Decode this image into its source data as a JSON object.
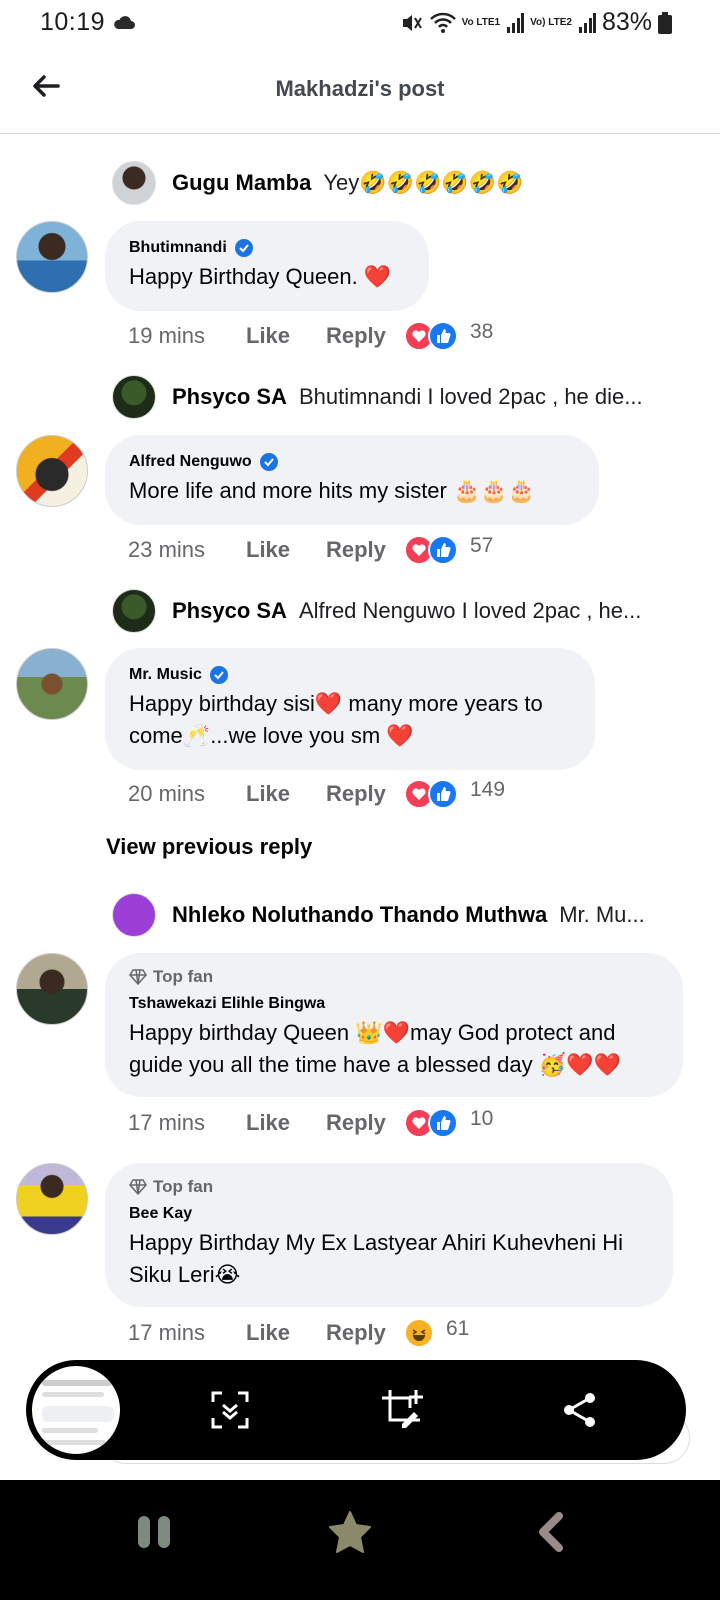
{
  "status": {
    "time": "10:19",
    "battery": "83%",
    "lte1": "Vo LTE1",
    "lte2": "Vo) LTE2"
  },
  "header": {
    "title": "Makhadzi's post",
    "back_icon": "arrow-left-icon"
  },
  "thread": [
    {
      "type": "reply",
      "name": "Gugu Mamba",
      "text": "Yey🤣🤣🤣🤣🤣🤣"
    },
    {
      "type": "comment",
      "name": "Bhutimnandi",
      "verified": true,
      "text": "Happy Birthday Queen. ❤️",
      "time": "19 mins",
      "like": "Like",
      "reply": "Reply",
      "count": "38"
    },
    {
      "type": "reply",
      "name": "Phsyco SA",
      "text": "Bhutimnandi I loved 2pac , he die..."
    },
    {
      "type": "comment",
      "name": "Alfred Nenguwo",
      "verified": true,
      "text": "More life and more hits my sister 🎂🎂🎂",
      "time": "23 mins",
      "like": "Like",
      "reply": "Reply",
      "count": "57"
    },
    {
      "type": "reply",
      "name": "Phsyco SA",
      "text": "Alfred Nenguwo I loved 2pac , he..."
    },
    {
      "type": "comment",
      "name": "Mr. Music",
      "verified": true,
      "text": "Happy birthday sisi❤️ many more years to come🥂...we love you sm ❤️",
      "time": "20 mins",
      "like": "Like",
      "reply": "Reply",
      "count": "149"
    },
    {
      "type": "view_previous",
      "text": "View previous reply"
    },
    {
      "type": "reply",
      "name": "Nhleko Noluthando Thando Muthwa",
      "text": "Mr. Mu..."
    },
    {
      "type": "comment",
      "badge": "Top fan",
      "name": "Tshawekazi Elihle Bingwa",
      "text": "Happy birthday Queen 👑❤️may God protect and guide you all the time have a blessed day 🥳❤️❤️",
      "time": "17 mins",
      "like": "Like",
      "reply": "Reply",
      "count": "10"
    },
    {
      "type": "comment",
      "badge": "Top fan",
      "name": "Bee Kay",
      "text": "Happy Birthday My Ex Lastyear Ahiri Kuhevheni Hi Siku Leri😭",
      "time": "17 mins",
      "like": "Like",
      "reply": "Reply",
      "count": "61"
    }
  ],
  "toolbar": {
    "icons": [
      "screenshot-thumbnail",
      "scroll-capture-icon",
      "crop-edit-icon",
      "share-icon"
    ]
  },
  "nav": {
    "icons": [
      "recent-apps-icon",
      "home-star-icon",
      "back-icon"
    ]
  },
  "colors": {
    "bubble": "#f0f2f5",
    "verified": "#1b74e4",
    "love": "#f33e58",
    "like": "#1877f2",
    "meta_text": "#65676b"
  }
}
